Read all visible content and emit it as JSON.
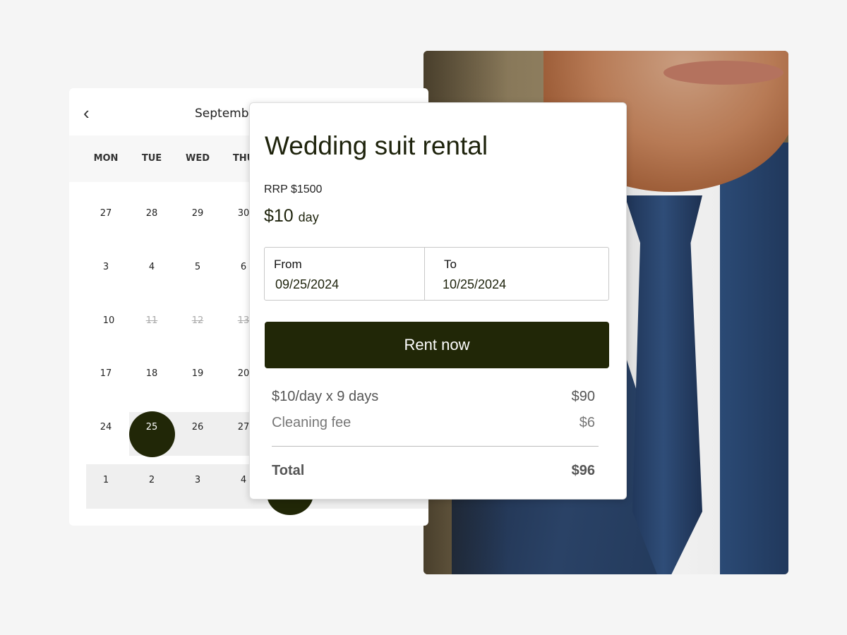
{
  "calendar": {
    "month_label": "Septemb",
    "weekdays": [
      "MON",
      "TUE",
      "WED",
      "THU"
    ],
    "rows": [
      [
        "27",
        "28",
        "29",
        "30"
      ],
      [
        "3",
        "4",
        "5",
        "6"
      ],
      [
        "10",
        "11",
        "12",
        "13"
      ],
      [
        "17",
        "18",
        "19",
        "20"
      ],
      [
        "24",
        "25",
        "26",
        "27"
      ],
      [
        "1",
        "2",
        "3",
        "4"
      ]
    ],
    "unavailable": [
      "11",
      "12",
      "13"
    ],
    "selected": "25"
  },
  "product": {
    "title": "Wedding suit rental",
    "rrp": "RRP $1500",
    "price": "$10",
    "price_unit": "day",
    "from_label": "From",
    "from_value": "09/25/2024",
    "to_label": "To",
    "to_value": "10/25/2024",
    "cta": "Rent now",
    "lines": [
      {
        "label": "$10/day x 9 days",
        "amount": "$90"
      },
      {
        "label": "Cleaning fee",
        "amount": "$6"
      }
    ],
    "total_label": "Total",
    "total_amount": "$96"
  },
  "colors": {
    "accent": "#212707",
    "background": "#f5f5f5"
  }
}
